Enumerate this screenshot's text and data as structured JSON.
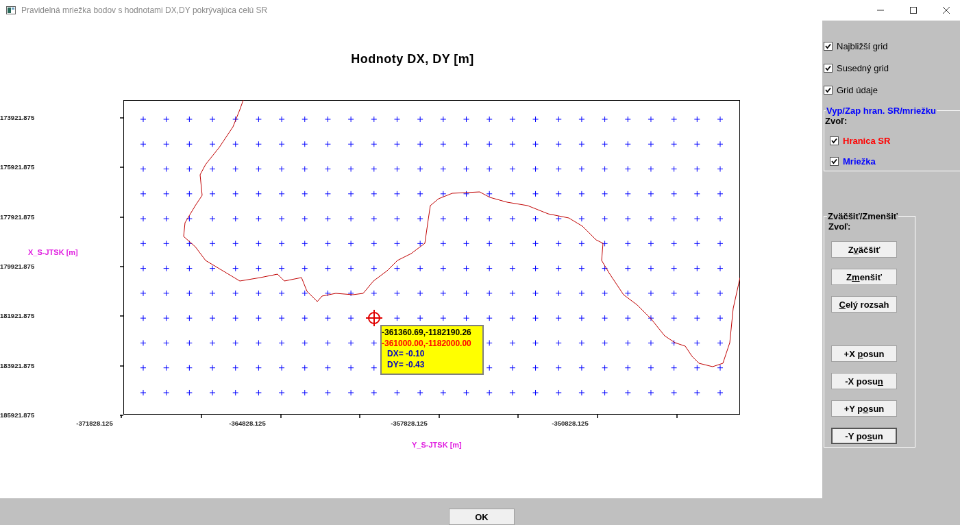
{
  "window": {
    "title": "Pravidelná mriežka bodov s hodnotami DX,DY pokrývajúca celú SR"
  },
  "plot": {
    "title": "Hodnoty DX, DY [m]",
    "ylabel": "X_S-JTSK [m]",
    "xlabel": "Y_S-JTSK [m]",
    "yticks": [
      "173921.875",
      "175921.875",
      "177921.875",
      "179921.875",
      "181921.875",
      "183921.875",
      "185921.875"
    ],
    "xticks": [
      "-371828.125",
      "-364828.125",
      "-357828.125",
      "-350828.125"
    ],
    "tooltip": [
      {
        "text": "-361360.69,-1182190.26",
        "color": "#000000"
      },
      {
        "text": "-361000.00,-1182000.00",
        "color": "#ff0000"
      },
      {
        "text": "DX= -0.10",
        "color": "#0000c0"
      },
      {
        "text": "DY= -0.43",
        "color": "#0000c0"
      }
    ]
  },
  "options": [
    {
      "label": "Najbližší grid",
      "checked": true
    },
    {
      "label": "Susedný grid",
      "checked": true
    },
    {
      "label": "Grid údaje",
      "checked": true
    }
  ],
  "layers": {
    "title": "Vyp/Zap hran. SR/mriežku",
    "prompt": "Zvoľ:",
    "items": [
      {
        "label": "Hranica SR",
        "checked": true,
        "color": "#ff0000"
      },
      {
        "label": "Mriežka",
        "checked": true,
        "color": "#0000ff"
      }
    ]
  },
  "zoom": {
    "title": "Zväčšiť/Zmenšiť",
    "prompt": "Zvoľ:",
    "buttons": [
      {
        "pre": "Z",
        "key": "v",
        "post": "äčšiť",
        "kind": "zoom"
      },
      {
        "pre": "Z",
        "key": "m",
        "post": "enšiť",
        "kind": "zoom"
      },
      {
        "key": "C",
        "post": "elý rozsah",
        "kind": "zoom"
      },
      {
        "pre": "+X ",
        "key": "p",
        "post": "osun",
        "kind": "pan"
      },
      {
        "pre": "-X posu",
        "key": "n",
        "kind": "pan"
      },
      {
        "pre": "+Y p",
        "key": "o",
        "post": "sun",
        "kind": "pan"
      },
      {
        "pre": "-Y po",
        "key": "s",
        "post": "un",
        "kind": "pan"
      }
    ]
  },
  "ok_button": "OK"
}
